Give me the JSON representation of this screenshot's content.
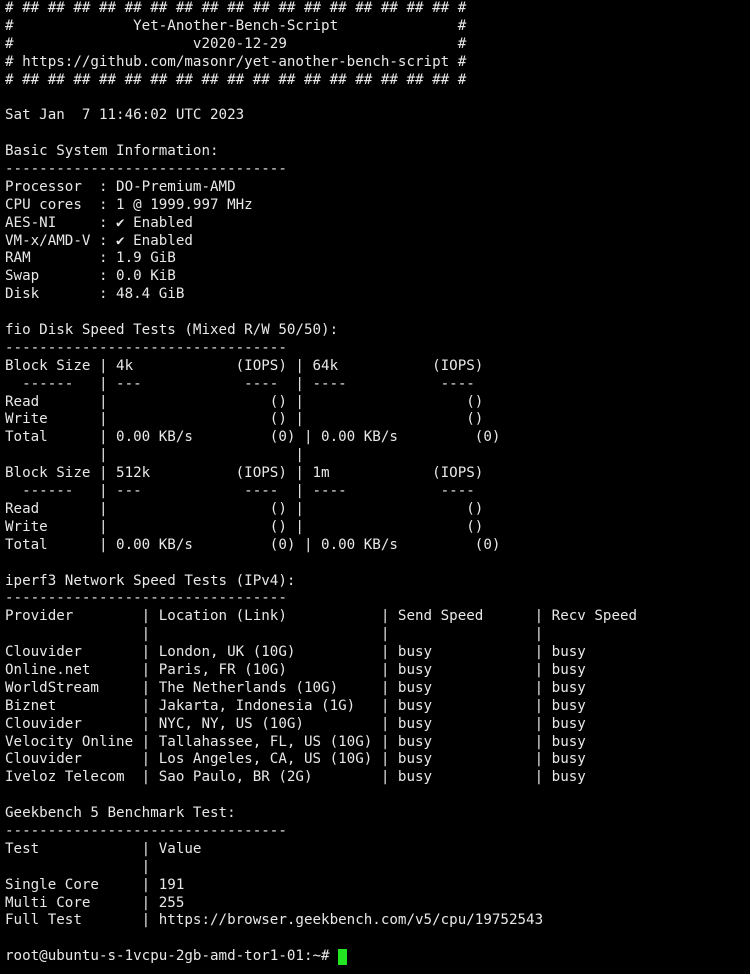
{
  "terminal": {
    "lines": [
      "# ## ## ## ## ## ## ## ## ## ## ## ## ## ## ## ## ## #",
      "#              Yet-Another-Bench-Script              #",
      "#                     v2020-12-29                    #",
      "# https://github.com/masonr/yet-another-bench-script #",
      "# ## ## ## ## ## ## ## ## ## ## ## ## ## ## ## ## ## #",
      "",
      "Sat Jan  7 11:46:02 UTC 2023",
      "",
      "Basic System Information:",
      "---------------------------------",
      "Processor  : DO-Premium-AMD",
      "CPU cores  : 1 @ 1999.997 MHz",
      "AES-NI     : ✔ Enabled",
      "VM-x/AMD-V : ✔ Enabled",
      "RAM        : 1.9 GiB",
      "Swap       : 0.0 KiB",
      "Disk       : 48.4 GiB",
      "",
      "fio Disk Speed Tests (Mixed R/W 50/50):",
      "---------------------------------",
      "Block Size | 4k            (IOPS) | 64k           (IOPS)",
      "  ------   | ---            ----  | ----           ---- ",
      "Read       |                   () |                   ()",
      "Write      |                   () |                   ()",
      "Total      | 0.00 KB/s         (0) | 0.00 KB/s         (0)",
      "           |                      |                     ",
      "Block Size | 512k          (IOPS) | 1m            (IOPS)",
      "  ------   | ---            ----  | ----           ---- ",
      "Read       |                   () |                   ()",
      "Write      |                   () |                   ()",
      "Total      | 0.00 KB/s         (0) | 0.00 KB/s         (0)",
      "",
      "iperf3 Network Speed Tests (IPv4):",
      "---------------------------------",
      "Provider        | Location (Link)           | Send Speed      | Recv Speed",
      "                |                           |                 |",
      "Clouvider       | London, UK (10G)          | busy            | busy",
      "Online.net      | Paris, FR (10G)           | busy            | busy",
      "WorldStream     | The Netherlands (10G)     | busy            | busy",
      "Biznet          | Jakarta, Indonesia (1G)   | busy            | busy",
      "Clouvider       | NYC, NY, US (10G)         | busy            | busy",
      "Velocity Online | Tallahassee, FL, US (10G) | busy            | busy",
      "Clouvider       | Los Angeles, CA, US (10G) | busy            | busy",
      "Iveloz Telecom  | Sao Paulo, BR (2G)        | busy            | busy",
      "",
      "Geekbench 5 Benchmark Test:",
      "---------------------------------",
      "Test            | Value",
      "                |",
      "Single Core     | 191",
      "Multi Core      | 255",
      "Full Test       | https://browser.geekbench.com/v5/cpu/19752543",
      ""
    ],
    "prompt": "root@ubuntu-s-1vcpu-2gb-amd-tor1-01:~# ",
    "colors": {
      "background": "#000000",
      "foreground": "#e8e8e8",
      "cursor": "#22e622"
    }
  }
}
